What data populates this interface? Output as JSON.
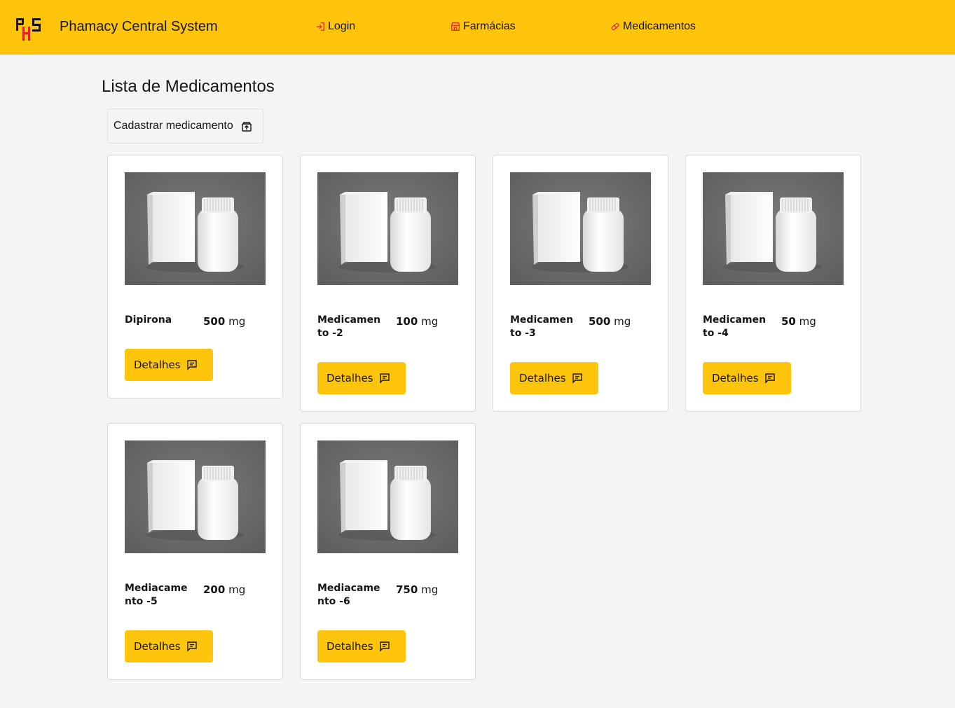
{
  "header": {
    "app_title": "Phamacy Central System",
    "logo_text": "PHS",
    "nav": [
      {
        "label": "Login",
        "icon": "login-icon"
      },
      {
        "label": "Farmácias",
        "icon": "store-icon"
      },
      {
        "label": "Medicamentos",
        "icon": "pill-icon"
      }
    ],
    "accent_color": "#ffc40c"
  },
  "main": {
    "title": "Lista de Medicamentos",
    "add_button_label": "Cadastrar medicamento"
  },
  "cards": [
    {
      "name": "Dipirona",
      "dose": "500",
      "unit": "mg",
      "button_label": "Detalhes"
    },
    {
      "name": "Medicamen to -2",
      "dose": "100",
      "unit": "mg",
      "button_label": "Detalhes"
    },
    {
      "name": "Medicamen to -3",
      "dose": "500",
      "unit": "mg",
      "button_label": "Detalhes"
    },
    {
      "name": "Medicamen to -4",
      "dose": "50",
      "unit": "mg",
      "button_label": "Detalhes"
    },
    {
      "name": "Mediacame nto -5",
      "dose": "200",
      "unit": "mg",
      "button_label": "Detalhes"
    },
    {
      "name": "Mediacame nto -6",
      "dose": "750",
      "unit": "mg",
      "button_label": "Detalhes"
    }
  ]
}
